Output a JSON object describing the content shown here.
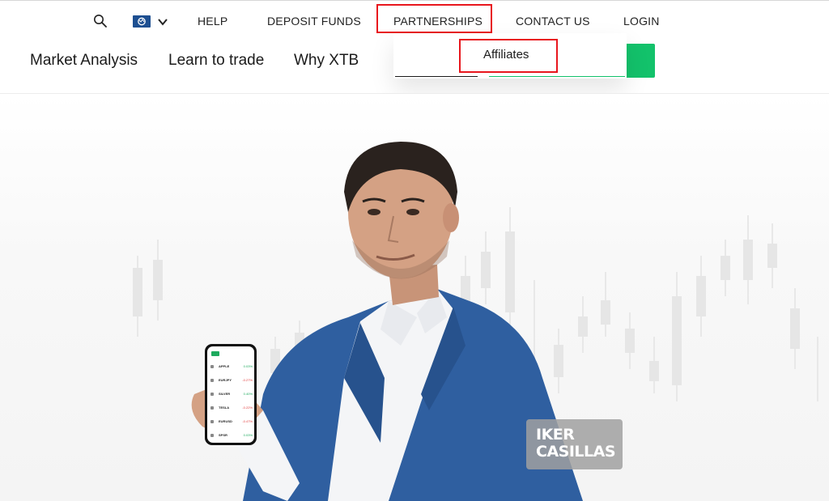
{
  "top_nav": {
    "help": "HELP",
    "deposit_funds": "DEPOSIT FUNDS",
    "partnerships": "PARTNERSHIPS",
    "contact_us": "CONTACT US",
    "login": "LOGIN",
    "search_icon": "search-icon",
    "language_icon": "globe-flag-icon"
  },
  "main_nav": {
    "market_analysis": "Market Analysis",
    "learn_to_trade": "Learn to trade",
    "why_xtb": "Why XTB"
  },
  "partnerships_dropdown": {
    "items": [
      "Affiliates"
    ]
  },
  "hero": {
    "badge_line1": "IKER",
    "badge_line2": "CASILLAS",
    "phone": {
      "tickers": [
        {
          "name": "APPLE",
          "change": "0.03%",
          "direction": "up"
        },
        {
          "name": "EURJPY",
          "change": "-0.27%",
          "direction": "down"
        },
        {
          "name": "SILVER",
          "change": "0.40%",
          "direction": "up"
        },
        {
          "name": "TESLA",
          "change": "-0.22%",
          "direction": "down"
        },
        {
          "name": "EURUSD",
          "change": "-0.47%",
          "direction": "down"
        },
        {
          "name": "SPSR",
          "change": "0.03%",
          "direction": "up"
        }
      ]
    }
  },
  "colors": {
    "accent_green": "#13c26b",
    "highlight_red": "#e8161d",
    "jacket_blue": "#2f5fa0"
  }
}
